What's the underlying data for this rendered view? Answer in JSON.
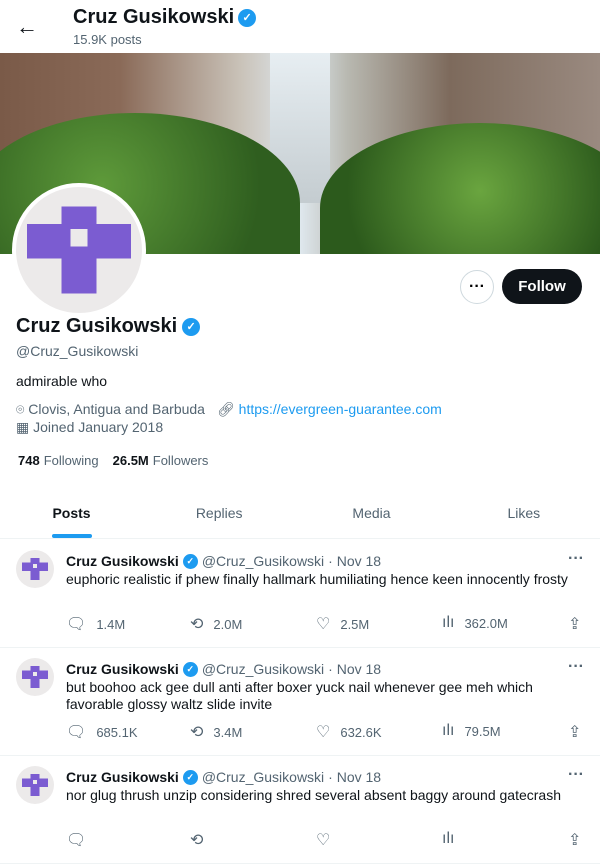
{
  "header": {
    "name": "Cruz Gusikowski",
    "posts": "15.9K posts"
  },
  "profile": {
    "name": "Cruz Gusikowski",
    "handle": "@Cruz_Gusikowski",
    "bio": "admirable who",
    "location": "Clovis, Antigua and Barbuda",
    "url": "https://evergreen-guarantee.com",
    "joined": "Joined January 2018",
    "following_count": "748",
    "following_label": "Following",
    "followers_count": "26.5M",
    "followers_label": "Followers",
    "follow_label": "Follow",
    "more_label": "···"
  },
  "colors": {
    "accent": "#1d9bf0",
    "avatar": "#7b5cd1"
  },
  "tabs": [
    "Posts",
    "Replies",
    "Media",
    "Likes"
  ],
  "tweets": [
    {
      "name": "Cruz Gusikowski",
      "handle": "@Cruz_Gusikowski",
      "date": "· Nov 18",
      "text": "euphoric realistic if phew finally hallmark humiliating hence keen innocently frosty",
      "replies": "1.4M",
      "reposts": "2.0M",
      "likes": "2.5M",
      "views": "362.0M"
    },
    {
      "name": "Cruz Gusikowski",
      "handle": "@Cruz_Gusikowski",
      "date": "· Nov 18",
      "text": "but boohoo ack gee dull anti after boxer yuck nail whenever gee meh which favorable glossy waltz slide invite",
      "replies": "685.1K",
      "reposts": "3.4M",
      "likes": "632.6K",
      "views": "79.5M"
    },
    {
      "name": "Cruz Gusikowski",
      "handle": "@Cruz_Gusikowski",
      "date": "· Nov 18",
      "text": "nor glug thrush unzip considering shred several absent baggy around gatecrash",
      "replies": "",
      "reposts": "",
      "likes": "",
      "views": ""
    }
  ]
}
